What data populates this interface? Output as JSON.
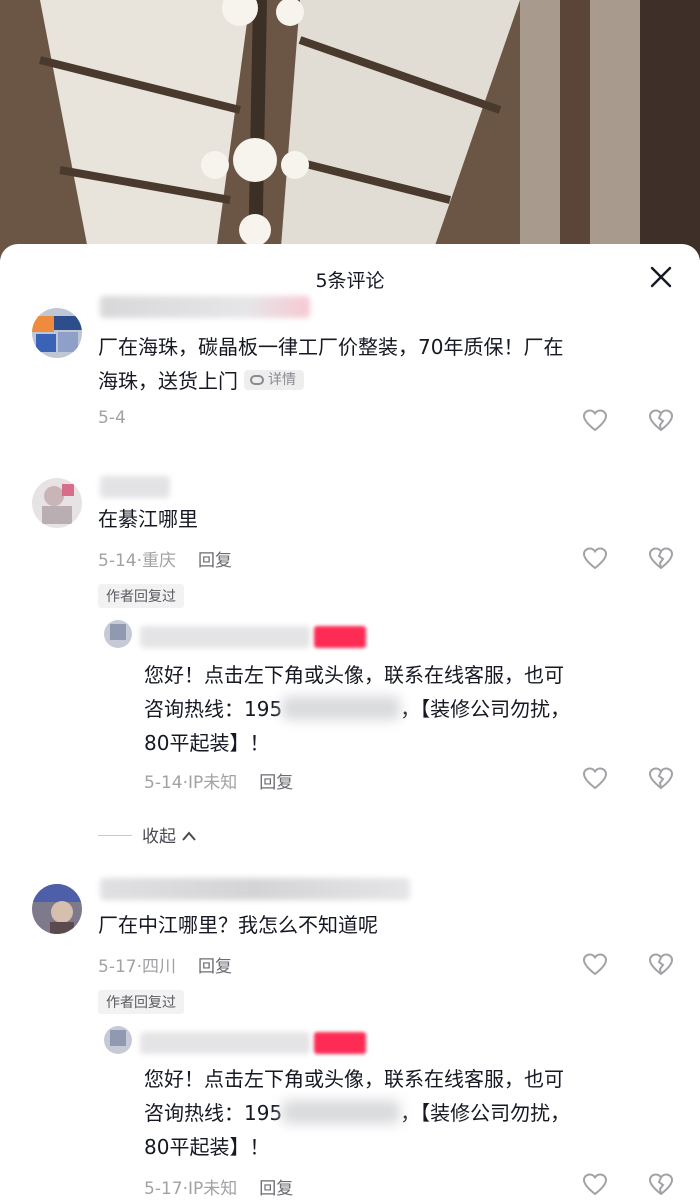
{
  "header": {
    "title": "5条评论"
  },
  "comments": [
    {
      "text_line1": "厂在海珠，碳晶板一律工厂价整装，70年质保！厂在",
      "text_line2": "海珠，送货上门",
      "detail_label": "详情",
      "date": "5-4",
      "location": "",
      "reply_label": ""
    },
    {
      "text_line1": "在綦江哪里",
      "date": "5-14",
      "location": "重庆",
      "reply_label": "回复",
      "author_replied_label": "作者回复过",
      "reply": {
        "line1": "您好！点击左下角或头像，联系在线客服，也可",
        "line2_prefix": "咨询热线：195",
        "line2_suffix": "，【装修公司勿扰，",
        "line3": "80平起装】！",
        "date": "5-14",
        "location": "IP未知",
        "reply_label": "回复"
      },
      "collapse_label": "收起"
    },
    {
      "text_line1": "厂在中江哪里？我怎么不知道呢",
      "date": "5-17",
      "location": "四川",
      "reply_label": "回复",
      "author_replied_label": "作者回复过",
      "reply": {
        "line1": "您好！点击左下角或头像，联系在线客服，也可",
        "line2_prefix": "咨询热线：195",
        "line2_suffix": "，【装修公司勿扰，",
        "line3": "80平起装】！",
        "date": "5-17",
        "location": "IP未知",
        "reply_label": "回复"
      }
    }
  ],
  "colors": {
    "accent_red": "#fe2c55",
    "meta_gray": "#a1a2a6"
  },
  "icons": [
    "close-icon",
    "heart-icon",
    "broken-heart-icon",
    "link-icon",
    "chevron-up-icon"
  ]
}
